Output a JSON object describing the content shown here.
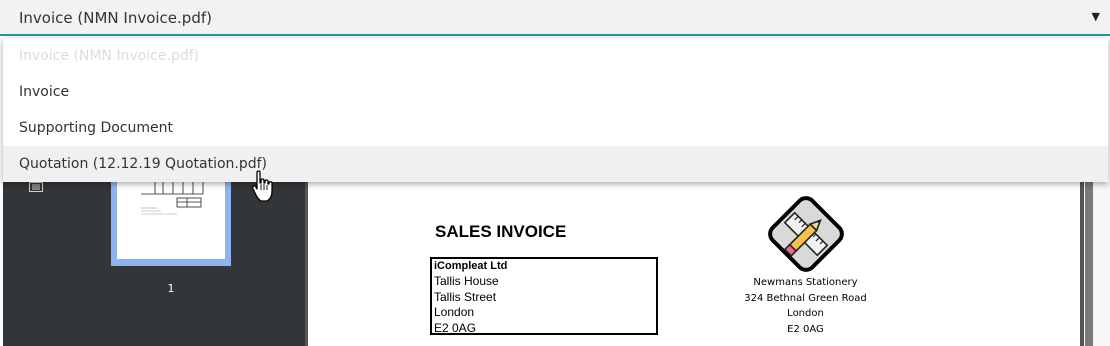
{
  "select": {
    "value": "Invoice (NMN Invoice.pdf)",
    "arrow_icon": "triangle-down-icon",
    "accent_color": "#1f9e8a"
  },
  "dropdown": {
    "options": [
      {
        "label": "Invoice (NMN Invoice.pdf)",
        "state": "disabled"
      },
      {
        "label": "Invoice",
        "state": "normal"
      },
      {
        "label": "Supporting Document",
        "state": "normal"
      },
      {
        "label": "Quotation (12.12.19 Quotation.pdf)",
        "state": "hover"
      }
    ]
  },
  "viewer": {
    "thumbnail_page_number": "1",
    "document": {
      "title": "SALES INVOICE",
      "sender": {
        "company": "iCompleat Ltd",
        "address": [
          "Tallis House",
          "Tallis Street",
          "London",
          "E2 0AG"
        ]
      },
      "recipient": {
        "lines": [
          "Newmans Stationery",
          "324 Bethnal Green Road",
          "London",
          "E2 0AG"
        ]
      },
      "logo_icon": "pencil-ruler-icon"
    }
  }
}
